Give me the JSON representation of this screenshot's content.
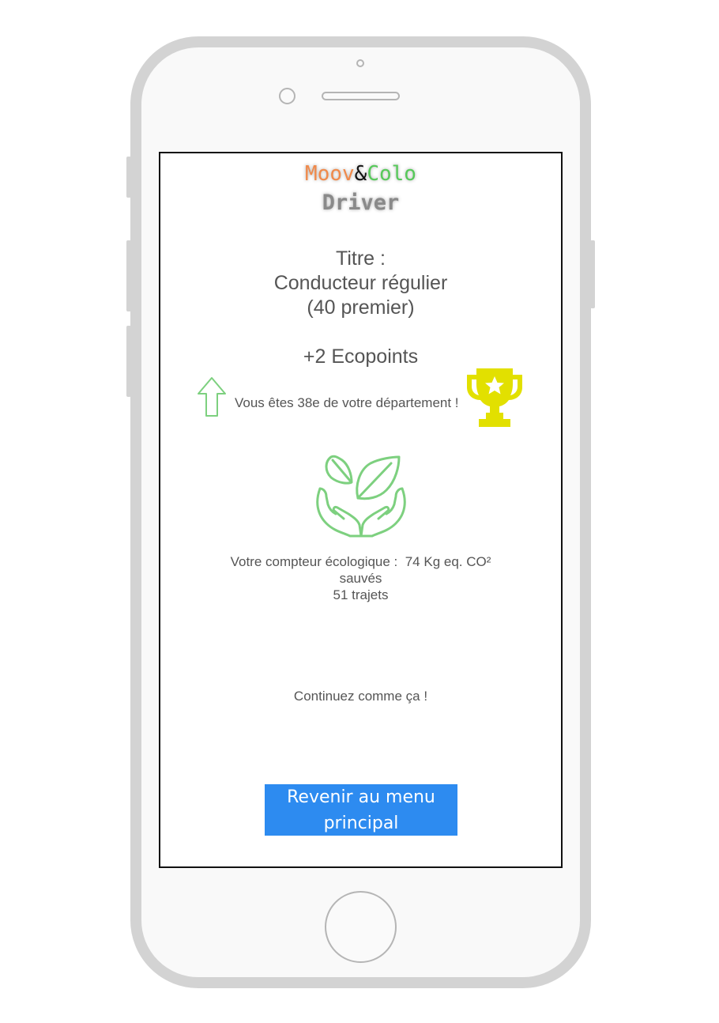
{
  "app": {
    "logo_moov": "Moov",
    "logo_amp": "&",
    "logo_colo": "Colo",
    "subtitle": "Driver"
  },
  "title": {
    "label": "Titre :",
    "name": "Conducteur régulier",
    "detail": "(40 premier)"
  },
  "reward": {
    "ecopoints": "+2 Ecopoints"
  },
  "ranking": {
    "text": "Vous êtes 38e de votre département !",
    "arrow_icon": "arrow-up-outline-icon",
    "trophy_icon": "trophy-star-icon"
  },
  "eco": {
    "icon": "hands-leaves-icon",
    "counter_line1": "Votre compteur écologique :  74 Kg eq. CO²",
    "counter_line2": "sauvés",
    "trips": "51 trajets"
  },
  "encouragement": "Continuez comme ça !",
  "button": {
    "line1": "Revenir au menu",
    "line2": "principal"
  },
  "colors": {
    "accent_orange": "#f08a4b",
    "accent_green": "#57c95a",
    "trophy_yellow": "#e2e000",
    "button_blue": "#2d8bf0",
    "text_gray": "#555555"
  }
}
